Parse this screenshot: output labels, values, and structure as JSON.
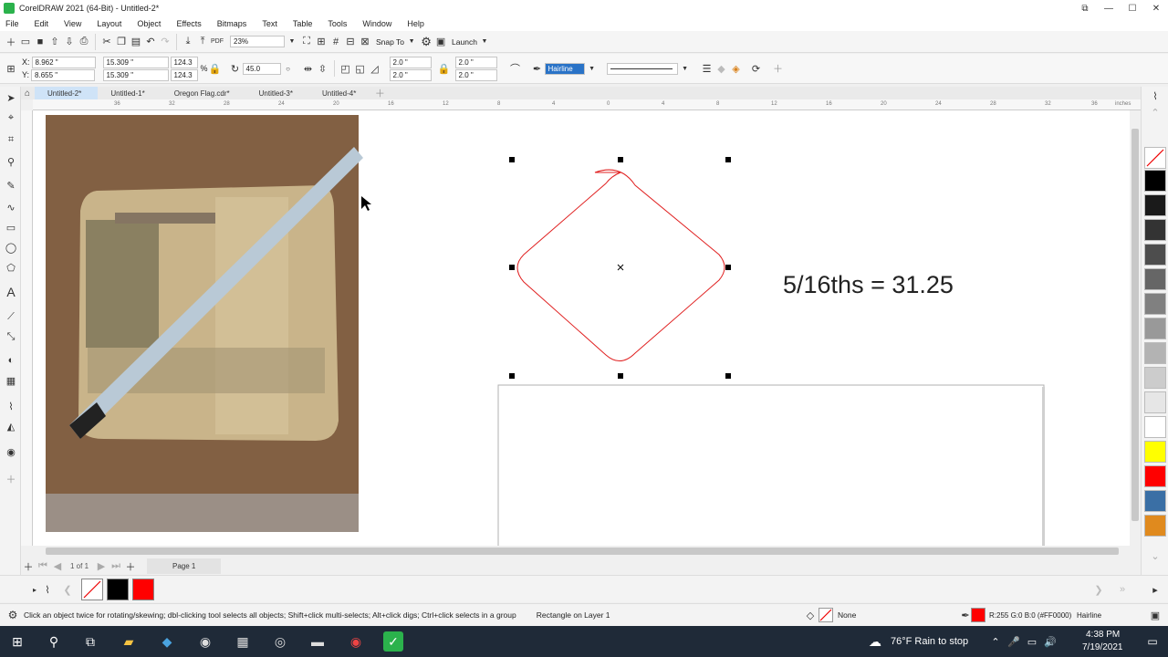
{
  "window": {
    "title": "CorelDRAW 2021 (64-Bit) - Untitled-2*",
    "min": "—",
    "max": "☐",
    "close": "✕",
    "restore": "⧉"
  },
  "menu": [
    "File",
    "Edit",
    "View",
    "Layout",
    "Object",
    "Effects",
    "Bitmaps",
    "Text",
    "Table",
    "Tools",
    "Window",
    "Help"
  ],
  "toolbar": {
    "zoom": "23%",
    "snap_to": "Snap To",
    "launch": "Launch"
  },
  "propbar": {
    "x": "8.962 \"",
    "y": "8.655 \"",
    "w": "15.309 \"",
    "h": "15.309 \"",
    "scale_w": "124.3",
    "scale_h": "124.3",
    "pct": "%",
    "rotation": "45.0",
    "corner1": "2.0 \"",
    "corner2": "2.0 \"",
    "corner3": "2.0 \"",
    "corner4": "2.0 \"",
    "outline_width": "Hairline"
  },
  "tabs": [
    "Untitled-2*",
    "Untitled-1*",
    "Oregon Flag.cdr*",
    "Untitled-3*",
    "Untitled-4*"
  ],
  "ruler": {
    "unit": "inches",
    "ticks": [
      "36",
      "32",
      "28",
      "24",
      "20",
      "16",
      "12",
      "8",
      "4",
      "0",
      "4",
      "8",
      "12",
      "16",
      "20",
      "24",
      "28",
      "32",
      "36",
      "40"
    ]
  },
  "canvas": {
    "label": "5/16ths = 31.25"
  },
  "pagenav": {
    "page_count": "1 of 1",
    "page_tab": "Page 1"
  },
  "palette": {
    "colors": [
      "#000000",
      "#1a1a1a",
      "#333333",
      "#4d4d4d",
      "#666666",
      "#808080",
      "#999999",
      "#b3b3b3",
      "#cccccc",
      "#e6e6e6",
      "#ffffff",
      "#ffff00",
      "#ff0000",
      "#3a6fa5",
      "#e08a1e"
    ]
  },
  "docpalette": {
    "colors": [
      "none",
      "#000000",
      "#ff0000"
    ]
  },
  "status": {
    "hint": "Click an object twice for rotating/skewing; dbl-clicking tool selects all objects; Shift+click multi-selects; Alt+click digs; Ctrl+click selects in a group",
    "object": "Rectangle on Layer 1",
    "fill": "None",
    "outline_color": "R:255 G:0 B:0 (#FF0000)",
    "outline_width": "Hairline"
  },
  "taskbar": {
    "weather": "76°F  Rain to stop",
    "time": "4:38 PM",
    "date": "7/19/2021"
  }
}
